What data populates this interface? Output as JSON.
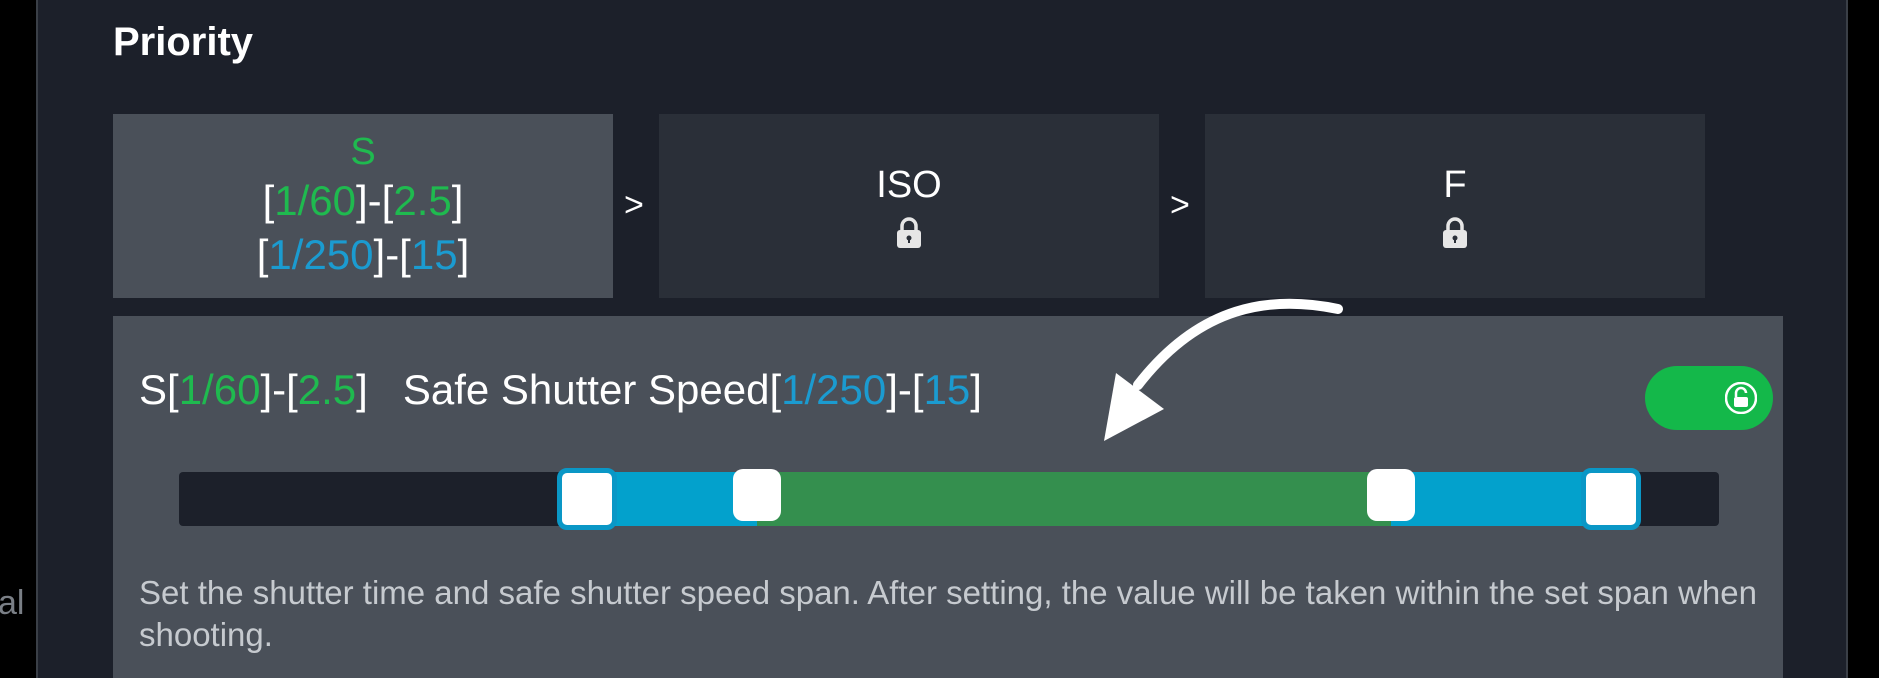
{
  "edge_text": "al",
  "title": "Priority",
  "priority_order": {
    "separator": ">",
    "cards": [
      {
        "label": "S",
        "active": true,
        "shutter_range": {
          "min": "1/60",
          "max": "2.5"
        },
        "safe_range": {
          "min": "1/250",
          "max": "15"
        }
      },
      {
        "label": "ISO",
        "active": false,
        "locked": true,
        "icon": "lock-icon"
      },
      {
        "label": "F",
        "active": false,
        "locked": true,
        "icon": "lock-icon"
      }
    ]
  },
  "detail": {
    "prefix": "S",
    "shutter_min": "1/60",
    "shutter_max": "2.5",
    "safe_label": "Safe Shutter Speed",
    "safe_min": "1/250",
    "safe_max": "15",
    "lock_toggle": {
      "state": "on",
      "icon": "unlock-icon",
      "color": "#14b84a"
    },
    "slider": {
      "safe_low": 0.265,
      "shutter_low": 0.375,
      "shutter_high": 0.787,
      "safe_high": 0.93
    },
    "description": "Set the shutter time and safe shutter speed span. After setting, the value will be taken within the set span when shooting."
  },
  "colors": {
    "accent_green": "#1fba4f",
    "accent_blue": "#1b9bd0",
    "panel_bg": "#1c202a",
    "card_active": "#4a5059"
  }
}
